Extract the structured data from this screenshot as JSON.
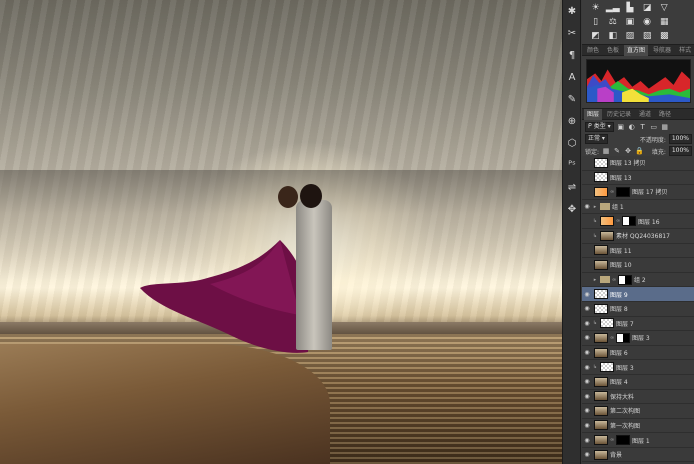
{
  "tool_icons": [
    "sun-icon",
    "scissors-icon",
    "paragraph-icon",
    "text-A-icon",
    "brush-icon",
    "stamp-icon",
    "cube-icon",
    "ps-icon",
    "slider-icon",
    "move-icon"
  ],
  "adjustment_icons": [
    "☀",
    "▂▃",
    "▙",
    "◪",
    "▽",
    "",
    "▯",
    "⚖",
    "▣",
    "◉",
    "▦",
    "",
    "◩",
    "◧",
    "▨",
    "▧",
    "▩",
    ""
  ],
  "tabs_top": [
    {
      "label": "颜色",
      "active": false
    },
    {
      "label": "色板",
      "active": false
    },
    {
      "label": "直方图",
      "active": true
    },
    {
      "label": "导航器",
      "active": false
    },
    {
      "label": "样式",
      "active": false
    }
  ],
  "tabs_bottom": [
    {
      "label": "图层",
      "active": true
    },
    {
      "label": "历史记录",
      "active": false
    },
    {
      "label": "通道",
      "active": false
    },
    {
      "label": "路径",
      "active": false
    }
  ],
  "layer_filter": {
    "kind": "类型"
  },
  "blend_mode": "正常",
  "opacity": {
    "label": "不透明度:",
    "value": "100%"
  },
  "lock": {
    "label": "锁定:"
  },
  "fill": {
    "label": "填充:",
    "value": "100%"
  },
  "layers": [
    {
      "name": "图层 13 拷贝",
      "thumb": "checker",
      "visible": false,
      "selected": false,
      "indent": 0
    },
    {
      "name": "图层 13",
      "thumb": "checker",
      "visible": false,
      "selected": false,
      "indent": 0
    },
    {
      "name": "图层 17 拷贝",
      "thumb": "warm",
      "visible": false,
      "selected": false,
      "indent": 0,
      "mask": "mask"
    },
    {
      "name": "组 1",
      "thumb": "folder",
      "visible": true,
      "selected": false,
      "indent": 0,
      "group": true
    },
    {
      "name": "图层 16",
      "thumb": "warm",
      "visible": false,
      "selected": false,
      "indent": 1,
      "mask": "maskw"
    },
    {
      "name": "素材 QQ24036817",
      "thumb": "photo",
      "visible": false,
      "selected": false,
      "indent": 1
    },
    {
      "name": "图层 11",
      "thumb": "photo",
      "visible": false,
      "selected": false,
      "indent": 0
    },
    {
      "name": "图层 10",
      "thumb": "photo",
      "visible": false,
      "selected": false,
      "indent": 0
    },
    {
      "name": "组 2",
      "thumb": "folder",
      "visible": false,
      "selected": false,
      "indent": 0,
      "group": true,
      "mask": "maskw"
    },
    {
      "name": "图层 9",
      "thumb": "checker",
      "visible": true,
      "selected": true,
      "indent": 0
    },
    {
      "name": "图层 8",
      "thumb": "checker",
      "visible": true,
      "selected": false,
      "indent": 0
    },
    {
      "name": "图层 7",
      "thumb": "checker",
      "visible": true,
      "selected": false,
      "indent": 1
    },
    {
      "name": "图层 3",
      "thumb": "photo",
      "visible": true,
      "selected": false,
      "indent": 0,
      "mask": "maskw"
    },
    {
      "name": "图层 6",
      "thumb": "photo",
      "visible": true,
      "selected": false,
      "indent": 0
    },
    {
      "name": "图层 3",
      "thumb": "checker",
      "visible": true,
      "selected": false,
      "indent": 1
    },
    {
      "name": "图层 4",
      "thumb": "photo",
      "visible": true,
      "selected": false,
      "indent": 0
    },
    {
      "name": "保持大料",
      "thumb": "photo",
      "visible": true,
      "selected": false,
      "indent": 0
    },
    {
      "name": "第二次构图",
      "thumb": "photo",
      "visible": true,
      "selected": false,
      "indent": 0
    },
    {
      "name": "第一次构图",
      "thumb": "photo",
      "visible": true,
      "selected": false,
      "indent": 0
    },
    {
      "name": "图层 1",
      "thumb": "photo",
      "visible": true,
      "selected": false,
      "indent": 0,
      "mask": "mask"
    },
    {
      "name": "背景",
      "thumb": "photo",
      "visible": true,
      "selected": false,
      "indent": 0
    }
  ]
}
